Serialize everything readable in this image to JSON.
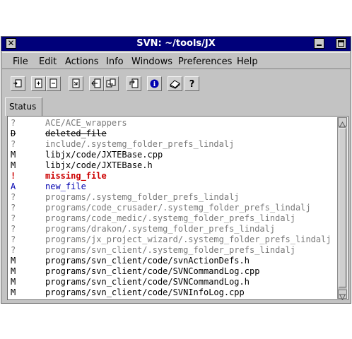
{
  "window": {
    "title": "SVN: ~/tools/JX",
    "close_glyph": "✕"
  },
  "menu": [
    {
      "label": "File"
    },
    {
      "label": "Edit"
    },
    {
      "label": "Actions"
    },
    {
      "label": "Info"
    },
    {
      "label": "Windows"
    },
    {
      "label": "Preferences"
    },
    {
      "label": "Help"
    }
  ],
  "toolbar": {
    "icons": [
      "update-icon",
      "add-icon",
      "remove-icon",
      "resolve-icon",
      "revert-icon",
      "commit-icon",
      "refresh-icon",
      "info-icon",
      "documentation-icon",
      "help-icon"
    ],
    "help_glyph": "?",
    "info_glyph": "i"
  },
  "tabs": [
    {
      "label": "Status"
    }
  ],
  "colors": {
    "title_bar": "#00007a",
    "window_bg": "#c3c3c3",
    "unversioned": "#7a7a7a",
    "added": "#0000b0",
    "missing": "#cc0000"
  },
  "status": {
    "rows": [
      {
        "code": "?",
        "path": "ACE/ACE_wrappers",
        "kind": "unv"
      },
      {
        "code": "D",
        "path": "deleted_file",
        "kind": "del"
      },
      {
        "code": "?",
        "path": "include/.systemg_folder_prefs_lindalj",
        "kind": "unv"
      },
      {
        "code": "M",
        "path": "libjx/code/JXTEBase.cpp",
        "kind": "mod"
      },
      {
        "code": "M",
        "path": "libjx/code/JXTEBase.h",
        "kind": "mod"
      },
      {
        "code": "!",
        "path": "missing_file",
        "kind": "miss"
      },
      {
        "code": "A",
        "path": "new_file",
        "kind": "add"
      },
      {
        "code": "?",
        "path": "programs/.systemg_folder_prefs_lindalj",
        "kind": "unv"
      },
      {
        "code": "?",
        "path": "programs/code_crusader/.systemg_folder_prefs_lindalj",
        "kind": "unv"
      },
      {
        "code": "?",
        "path": "programs/code_medic/.systemg_folder_prefs_lindalj",
        "kind": "unv"
      },
      {
        "code": "?",
        "path": "programs/drakon/.systemg_folder_prefs_lindalj",
        "kind": "unv"
      },
      {
        "code": "?",
        "path": "programs/jx_project_wizard/.systemg_folder_prefs_lindalj",
        "kind": "unv"
      },
      {
        "code": "?",
        "path": "programs/svn_client/.systemg_folder_prefs_lindalj",
        "kind": "unv"
      },
      {
        "code": "M",
        "path": "programs/svn_client/code/svnActionDefs.h",
        "kind": "mod"
      },
      {
        "code": "M",
        "path": "programs/svn_client/code/SVNCommandLog.cpp",
        "kind": "mod"
      },
      {
        "code": "M",
        "path": "programs/svn_client/code/SVNCommandLog.h",
        "kind": "mod"
      },
      {
        "code": "M",
        "path": "programs/svn_client/code/SVNInfoLog.cpp",
        "kind": "mod"
      }
    ]
  }
}
